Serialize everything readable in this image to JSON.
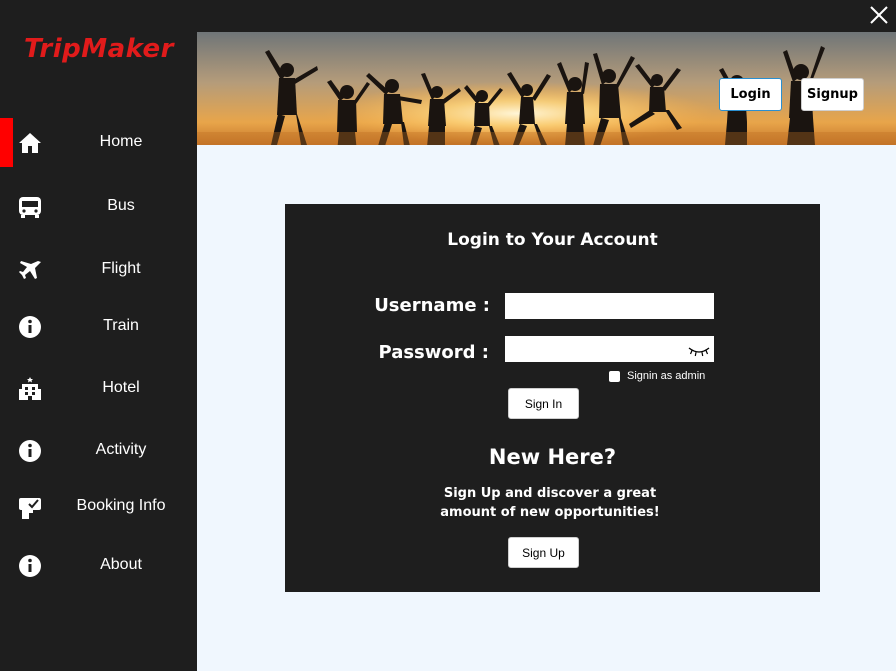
{
  "app": {
    "logo": "TripMaker"
  },
  "sidebar": {
    "items": [
      {
        "label": "Home",
        "icon": "home-icon",
        "active": true
      },
      {
        "label": "Bus",
        "icon": "bus-icon"
      },
      {
        "label": "Flight",
        "icon": "plane-icon"
      },
      {
        "label": "Train",
        "icon": "info-icon"
      },
      {
        "label": "Hotel",
        "icon": "hotel-icon"
      },
      {
        "label": "Activity",
        "icon": "info-icon"
      },
      {
        "label": "Booking Info",
        "icon": "booking-icon"
      },
      {
        "label": "About",
        "icon": "info-icon"
      }
    ]
  },
  "header": {
    "login_label": "Login",
    "signup_label": "Signup"
  },
  "login": {
    "title": "Login to Your Account",
    "username_label": "Username :",
    "username_value": "",
    "password_label": "Password :",
    "password_value": "",
    "admin_label": "Signin as admin",
    "signin_label": "Sign In"
  },
  "signup": {
    "title": "New Here?",
    "pitch_line1": "Sign Up and discover a great",
    "pitch_line2": "amount of new opportunities!",
    "button_label": "Sign Up"
  },
  "colors": {
    "accent": "#ff0000",
    "logo": "#e11b1b",
    "dark": "#1e1e1e",
    "main_bg": "#f0f7fe"
  }
}
